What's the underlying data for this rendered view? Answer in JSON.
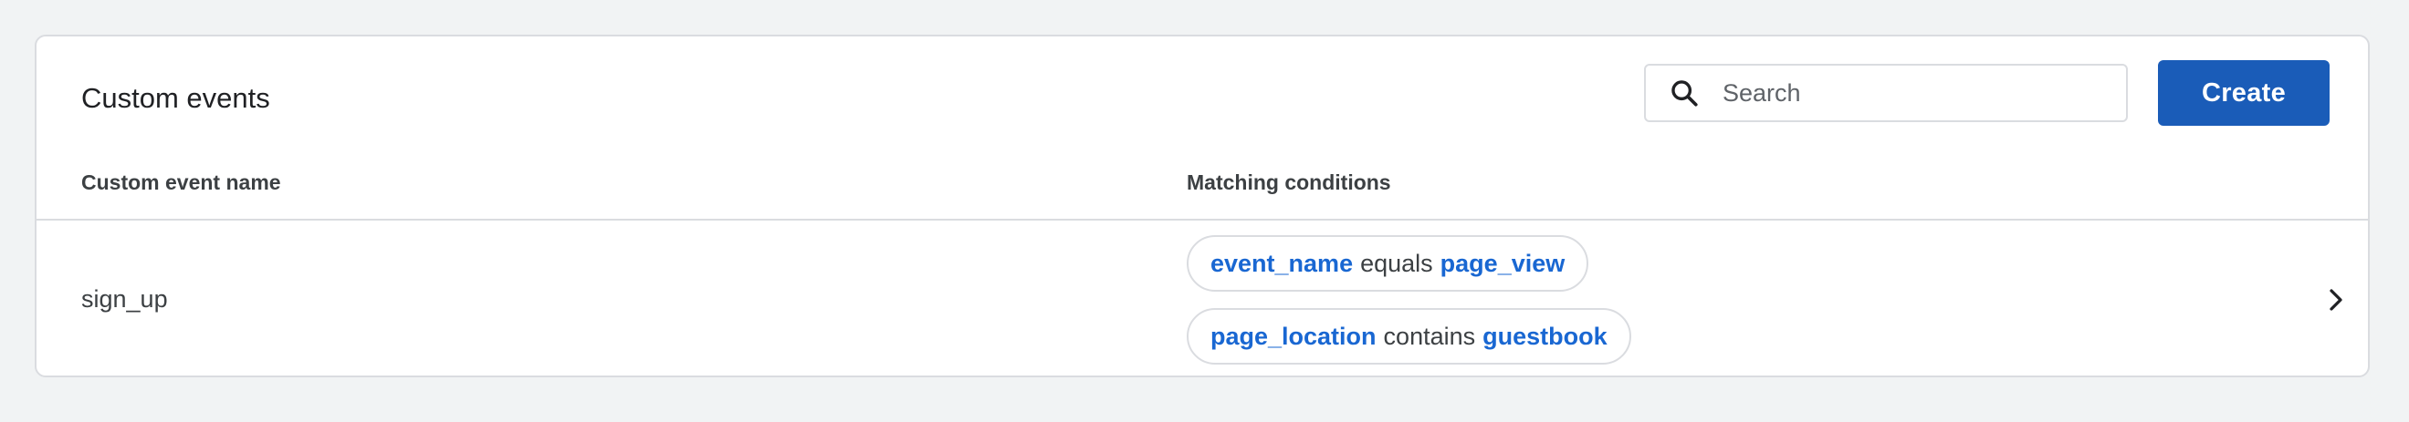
{
  "card": {
    "title": "Custom events"
  },
  "search": {
    "placeholder": "Search",
    "value": "",
    "icon": "search-icon"
  },
  "toolbar": {
    "create_label": "Create"
  },
  "table": {
    "columns": [
      "Custom event name",
      "Matching conditions"
    ],
    "rows": [
      {
        "name": "sign_up",
        "conditions": [
          {
            "field": "event_name",
            "operator": "equals",
            "value": "page_view"
          },
          {
            "field": "page_location",
            "operator": "contains",
            "value": "guestbook"
          }
        ],
        "icon": "chevron-right-icon"
      }
    ]
  },
  "colors": {
    "accent": "#1a5cb8",
    "link": "#1967d2",
    "background": "#f1f3f4",
    "border": "#dadce0",
    "text": "#202124"
  }
}
